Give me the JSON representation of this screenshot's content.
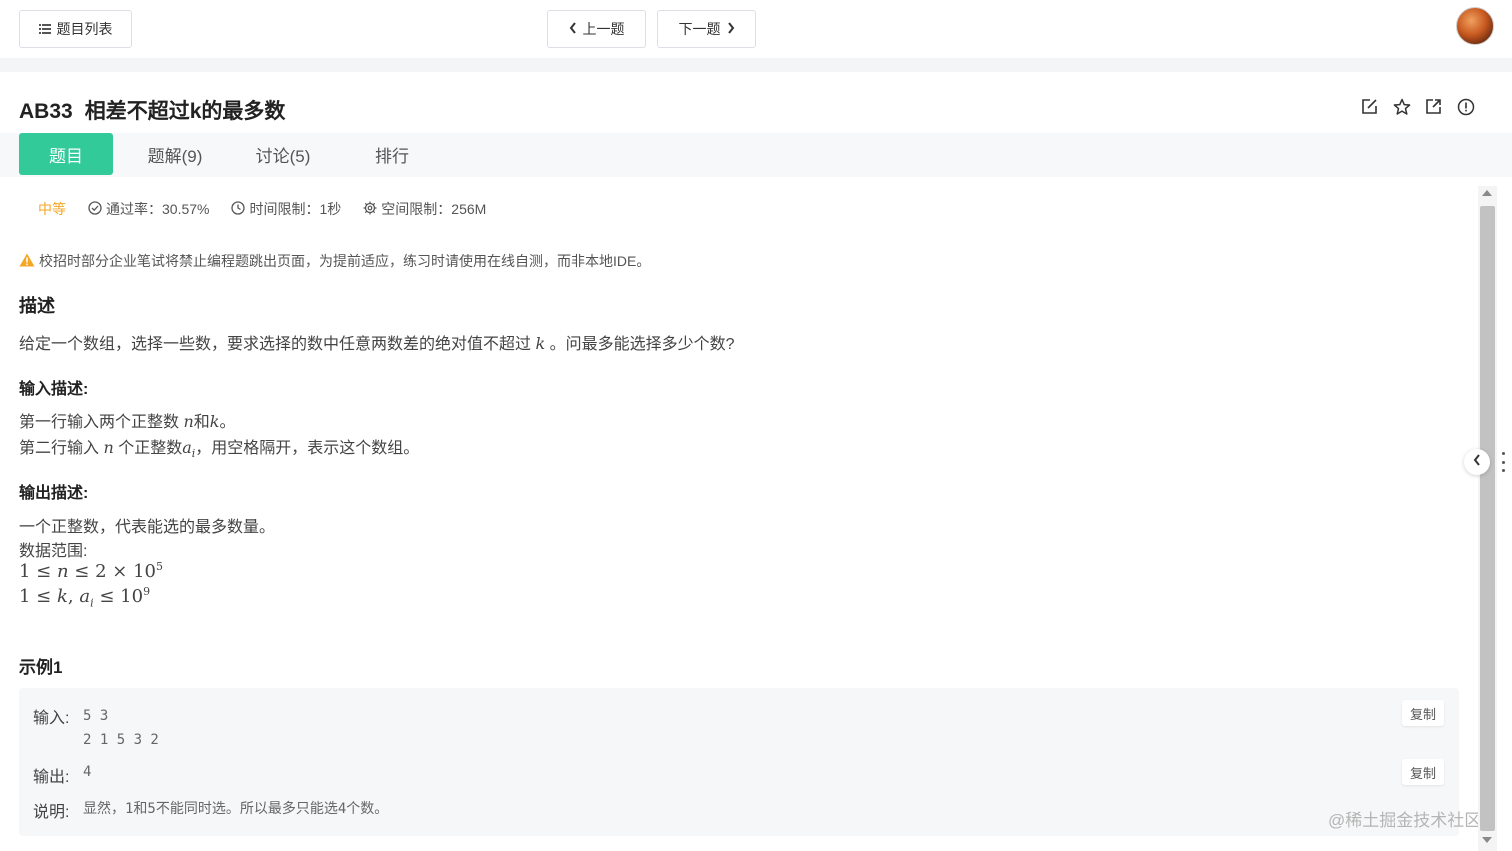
{
  "topbar": {
    "list_label": "题目列表",
    "prev_label": "上一题",
    "next_label": "下一题"
  },
  "problem": {
    "code": "AB33",
    "title": "相差不超过k的最多数"
  },
  "tabs": [
    {
      "label": "题目"
    },
    {
      "label": "题解(9)"
    },
    {
      "label": "讨论(5)"
    },
    {
      "label": "排行"
    }
  ],
  "meta": {
    "difficulty": "中等",
    "pass_rate": "通过率：30.57%",
    "time_limit": "时间限制：1秒",
    "memory_limit": "空间限制：256M"
  },
  "warning": "校招时部分企业笔试将禁止编程题跳出页面，为提前适应，练习时请使用在线自测，而非本地IDE。",
  "description": {
    "heading": "描述",
    "text_before": "给定一个数组，选择一些数，要求选择的数中任意两数差的绝对值不超过 ",
    "var_k": "k",
    "text_after": " 。问最多能选择多少个数?"
  },
  "input_desc": {
    "heading": "输入描述:",
    "line1_a": "第一行输入两个正整数 ",
    "line1_n": "n",
    "line1_b": "和",
    "line1_k": "k",
    "line1_c": "。",
    "line2_a": "第二行输入 ",
    "line2_n": "n",
    "line2_b": " 个正整数",
    "line2_a_var": "a",
    "line2_i": "i",
    "line2_c": "，用空格隔开，表示这个数组。"
  },
  "output_desc": {
    "heading": "输出描述:",
    "line1": "一个正整数，代表能选的最多数量。",
    "line2": "数据范围:",
    "range1_a": "1 ≤ ",
    "range1_n": "n",
    "range1_b": " ≤ 2 × 10",
    "range1_exp": "5",
    "range2_a": "1 ≤ ",
    "range2_k": "k",
    "range2_comma": ", ",
    "range2_var": "a",
    "range2_i": "i",
    "range2_b": " ≤ 10",
    "range2_exp": "9"
  },
  "example": {
    "heading": "示例1",
    "input_label": "输入:",
    "input_value": "5 3\n2 1 5 3 2",
    "output_label": "输出:",
    "output_value": "4",
    "note_label": "说明:",
    "note_value": "显然，1和5不能同时选。所以最多只能选4个数。",
    "copy_label": "复制"
  },
  "watermark": "@稀土掘金技术社区",
  "colors": {
    "accent": "#32ca99",
    "difficulty": "#f5a623",
    "warning": "#f5a623"
  }
}
